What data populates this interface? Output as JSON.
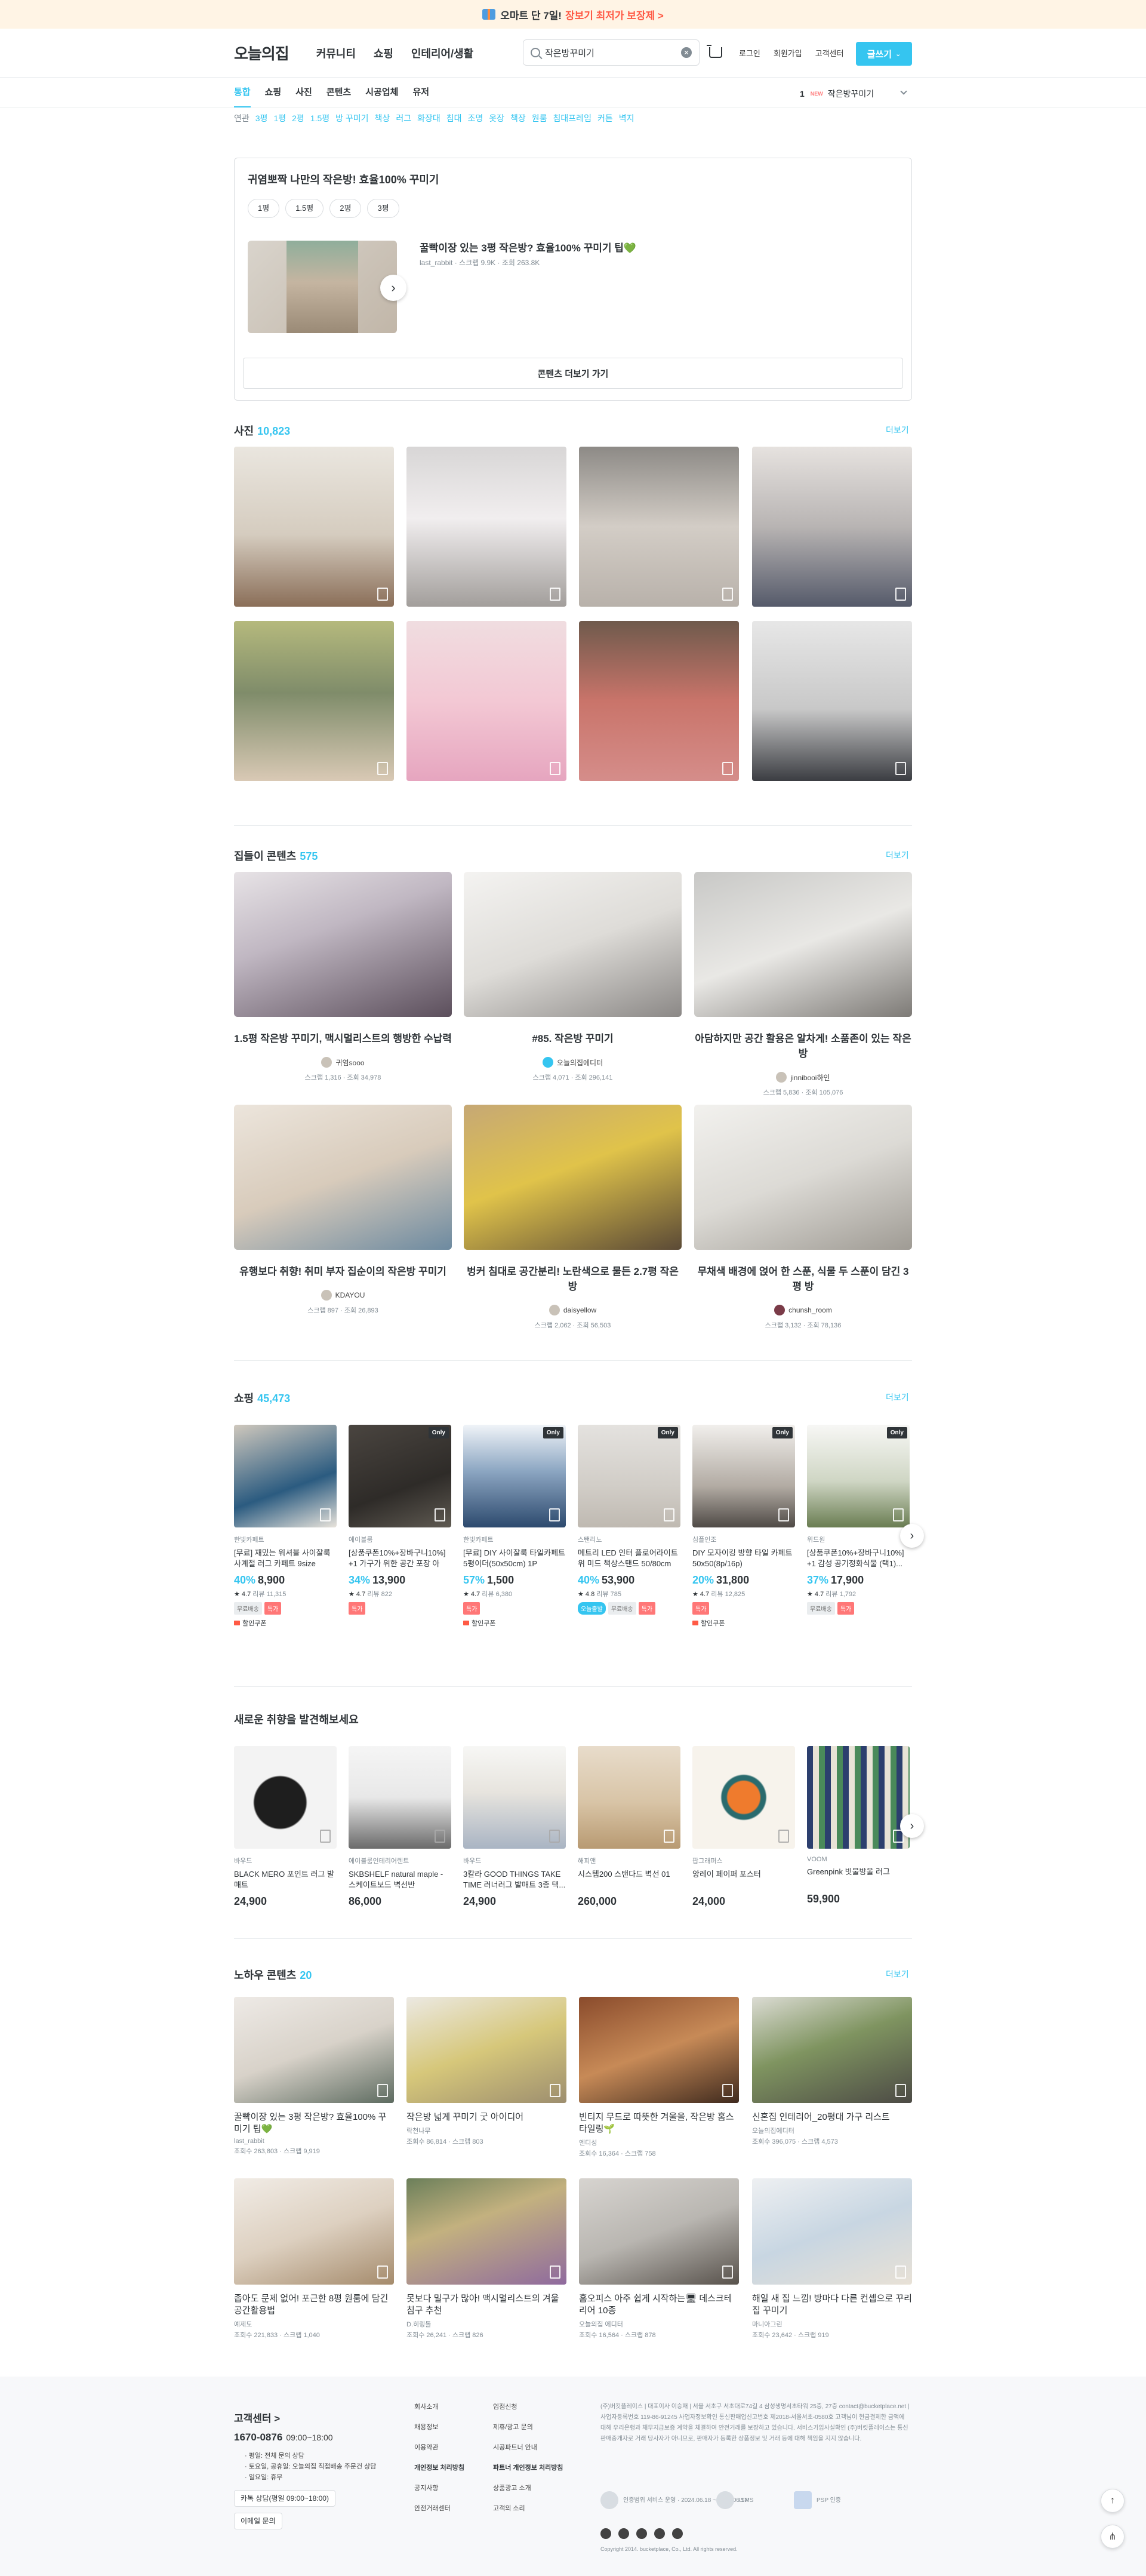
{
  "banner": {
    "text": "오마트 단 7일!",
    "accent": "장보기 최저가 보장제 >"
  },
  "gnb": {
    "logo": "오늘의집",
    "menu": [
      "커뮤니티",
      "쇼핑",
      "인테리어/생활"
    ],
    "search_value": "작은방꾸미기",
    "links": [
      "로그인",
      "회원가입",
      "고객센터"
    ],
    "write_button": "글쓰기"
  },
  "tabs": [
    "통합",
    "쇼핑",
    "사진",
    "콘텐츠",
    "시공업체",
    "유저"
  ],
  "trend": {
    "rank": "1",
    "badge": "NEW",
    "keyword": "작은방꾸미기"
  },
  "related": {
    "label": "연관",
    "keywords": [
      "3평",
      "1평",
      "2평",
      "1.5평",
      "방 꾸미기",
      "책상",
      "러그",
      "화장대",
      "침대",
      "조명",
      "옷장",
      "책장",
      "원룸",
      "침대프레임",
      "커튼",
      "벽지"
    ]
  },
  "featured": {
    "title": "귀염뽀짝 나만의 작은방! 효율100% 꾸미기",
    "chips": [
      "1평",
      "1.5평",
      "2평",
      "3평"
    ],
    "item_title": "꿀빡이장 있는 3평 작은방? 효율100% 꾸미기 팁💚",
    "item_author": "last_rabbit",
    "item_stats": "스크랩 9.9K · 조회 263.8K",
    "more_button": "콘텐츠 더보기 가기"
  },
  "photos": {
    "title": "사진",
    "count": "10,823",
    "more": "더보기"
  },
  "housewarming": {
    "title": "집들이 콘텐츠",
    "count": "575",
    "more": "더보기",
    "items": [
      {
        "title": "1.5평 작은방 꾸미기, 맥시멀리스트의 행방한 수납력",
        "user": "귀염sooo",
        "stats": "스크랩 1,316 · 조회 34,978"
      },
      {
        "title": "#85. 작은방 꾸미기",
        "user": "오늘의집에디터",
        "stats": "스크랩 4,071 · 조회 296,141"
      },
      {
        "title": "아담하지만 공간 활용은 알차게! 소품존이 있는 작은 방",
        "user": "jinnibooi하인",
        "stats": "스크랩 5,836 · 조회 105,076"
      },
      {
        "title": "유행보다 취향! 취미 부자 집순이의 작은방 꾸미기",
        "user": "KDAYOU",
        "stats": "스크랩 897 · 조회 26,893"
      },
      {
        "title": "벙커 침대로 공간분리! 노란색으로 물든 2.7평 작은방",
        "user": "daisyellow",
        "stats": "스크랩 2,062 · 조회 56,503"
      },
      {
        "title": "무채색 배경에 얹어 한 스푼, 식물 두 스푼이 담긴 3평 방",
        "user": "chunsh_room",
        "stats": "스크랩 3,132 · 조회 78,136"
      }
    ]
  },
  "shopping": {
    "title": "쇼핑",
    "count": "45,473",
    "more": "더보기",
    "items": [
      {
        "only": "",
        "brand": "한빛카페트",
        "name": "[무료] 재밌는 워셔블 사이잘룩 사계절 러그 카페트 9size 8co...",
        "rate": "40%",
        "price": "8,900",
        "rating": "★ 4.7",
        "reviews": "리뷰 11,315",
        "badges": [
          "무료배송",
          "특가"
        ],
        "coupon": "할인쿠폰"
      },
      {
        "only": "Only",
        "brand": "에이블룸",
        "name": "[상품쿠폰10%+장바구니10%] +1 가구가 위한 공간 포장 아이...",
        "rate": "34%",
        "price": "13,900",
        "rating": "★ 4.7",
        "reviews": "리뷰 822",
        "badges": [
          "특가"
        ],
        "coupon": ""
      },
      {
        "only": "Only",
        "brand": "한빛카페트",
        "name": "[무료] DIY 사이잘룩 타일카페트 5평이더(50x50cm) 1P",
        "rate": "57%",
        "price": "1,500",
        "rating": "★ 4.7",
        "reviews": "리뷰 6,380",
        "badges": [
          "특가"
        ],
        "coupon": "할인쿠폰"
      },
      {
        "only": "Only",
        "brand": "스탠리노",
        "name": "메트리 LED 인터 플로어라이트 위 미드 책상스탠드 50/80cm",
        "rate": "40%",
        "price": "53,900",
        "rating": "★ 4.8",
        "reviews": "리뷰 785",
        "badges": [
          "오늘출발",
          "무료배송",
          "특가"
        ],
        "coupon": ""
      },
      {
        "only": "Only",
        "brand": "심플인조",
        "name": "DIY 모자이킹 방향 타일 카페트 50x50(8p/16p)",
        "rate": "20%",
        "price": "31,800",
        "rating": "★ 4.7",
        "reviews": "리뷰 12,825",
        "badges": [
          "특가"
        ],
        "coupon": "할인쿠폰"
      },
      {
        "only": "Only",
        "brand": "위드원",
        "name": "[상품쿠폰10%+장바구니10%] +1 감성 공기정화식물 (택1)...",
        "rate": "37%",
        "price": "17,900",
        "rating": "★ 4.7",
        "reviews": "리뷰 1,792",
        "badges": [
          "무료배송",
          "특가"
        ],
        "coupon": ""
      }
    ]
  },
  "discover": {
    "title": "새로운 취향을 발견해보세요",
    "items": [
      {
        "brand": "바우드",
        "name": "BLACK MERO 포인트 러그 발 매트",
        "price": "24,900"
      },
      {
        "brand": "에이블룸인테리어렌트",
        "name": "SKBSHELF natural maple - 스케이트보드 벽선반",
        "price": "86,000"
      },
      {
        "brand": "바우드",
        "name": "3칼라 GOOD THINGS TAKE TIME 러너러그 발매트 3종 택...",
        "price": "24,900"
      },
      {
        "brand": "해피앤",
        "name": "시스템200 스탠다드 벽선 01",
        "price": "260,000"
      },
      {
        "brand": "팝그래퍼스",
        "name": "앙레이 페이퍼 포스터",
        "price": "24,000"
      },
      {
        "brand": "VOOM",
        "name": "Greenpink 빗물방울 러그",
        "price": "59,900"
      }
    ]
  },
  "knowhow": {
    "title": "노하우 콘텐츠",
    "count": "20",
    "more": "더보기",
    "items": [
      {
        "title": "꿀빡이장 있는 3평 작은방? 효율100% 꾸미기 팁💚",
        "author": "last_rabbit",
        "stats": "조회수 263,803 · 스크랩 9,919"
      },
      {
        "title": "작은방 넓게 꾸미기 굿 아이디어",
        "author": "락천나무",
        "stats": "조회수 86,814 · 스크랩 803"
      },
      {
        "title": "빈티지 무드로 따뜻한 겨울을, 작은방 홈스타일링🌱",
        "author": "엔디성",
        "stats": "조회수 16,364 · 스크랩 758"
      },
      {
        "title": "신혼집 인테리어_20평대 가구 리스트",
        "author": "오늘의집에디터",
        "stats": "조회수 396,075 · 스크랩 4,573"
      },
      {
        "title": "좁아도 문제 없어! 포근한 8평 원룸에 담긴 공간활용법",
        "author": "예제도",
        "stats": "조회수 221,833 · 스크랩 1,040"
      },
      {
        "title": "못보다 밀구가 많아! 맥시멀리스트의 겨울 침구 추천",
        "author": "D.히링돌",
        "stats": "조회수 26,241 · 스크랩 826"
      },
      {
        "title": "홈오피스 아주 쉽게 시작하는🖥 데스크테리어 10종",
        "author": "오늘의집 에디터",
        "stats": "조회수 16,564 · 스크랩 878"
      },
      {
        "title": "해일 새 집 느낌! 방마다 다른 컨셉으로 꾸리집 꾸미기",
        "author": "마니아그린",
        "stats": "조회수 23,642 · 스크랩 919"
      }
    ]
  },
  "footer": {
    "cs_title": "고객센터 >",
    "phone": "1670-0876",
    "hours": "09:00~18:00",
    "hours_detail": [
      "· 평일: 전체 문의 상담",
      "· 토요일, 공휴일: 오늘의집 직접배송 주문건 상담",
      "· 일요일: 휴무"
    ],
    "btn_kakao": "카톡 상담(평일 09:00~18:00)",
    "btn_email": "이메일 문의",
    "col1": [
      "회사소개",
      "채용정보",
      "이용약관",
      "개인정보 처리방침",
      "공지사항",
      "안전거래센터"
    ],
    "col2": [
      "입점신청",
      "제휴/광고 문의",
      "시공파트너 안내",
      "파트너 개인정보 처리방침",
      "상품광고 소개",
      "고객의 소리"
    ],
    "legal": "(주)버킷플레이스 | 대표이사 이승재 | 서울 서초구 서초대로74길 4 삼성생명서초타워 25층, 27층 contact@bucketplace.net | 사업자등록번호 119-86-91245 사업자정보확인 통신판매업신고번호 제2018-서울서초-0580호 고객님이 현금결제한 금액에 대해 우리은행과 채무지급보증 계약을 체결하여 안전거래를 보장하고 있습니다. 서비스가입사실확인 (주)버킷플레이스는 통신판매중개자로 거래 당사자가 아니므로, 판매자가 등록한 상품정보 및 거래 등에 대해 책임을 지지 않습니다.",
    "cert1": "인증범위 서비스 운영 · 2024.06.18 ~ 2027.06.17",
    "cert2": "ISMS",
    "cert3": "PSP 인증",
    "copyright": "Copyright 2014. bucketplace, Co., Ltd. All rights reserved."
  }
}
